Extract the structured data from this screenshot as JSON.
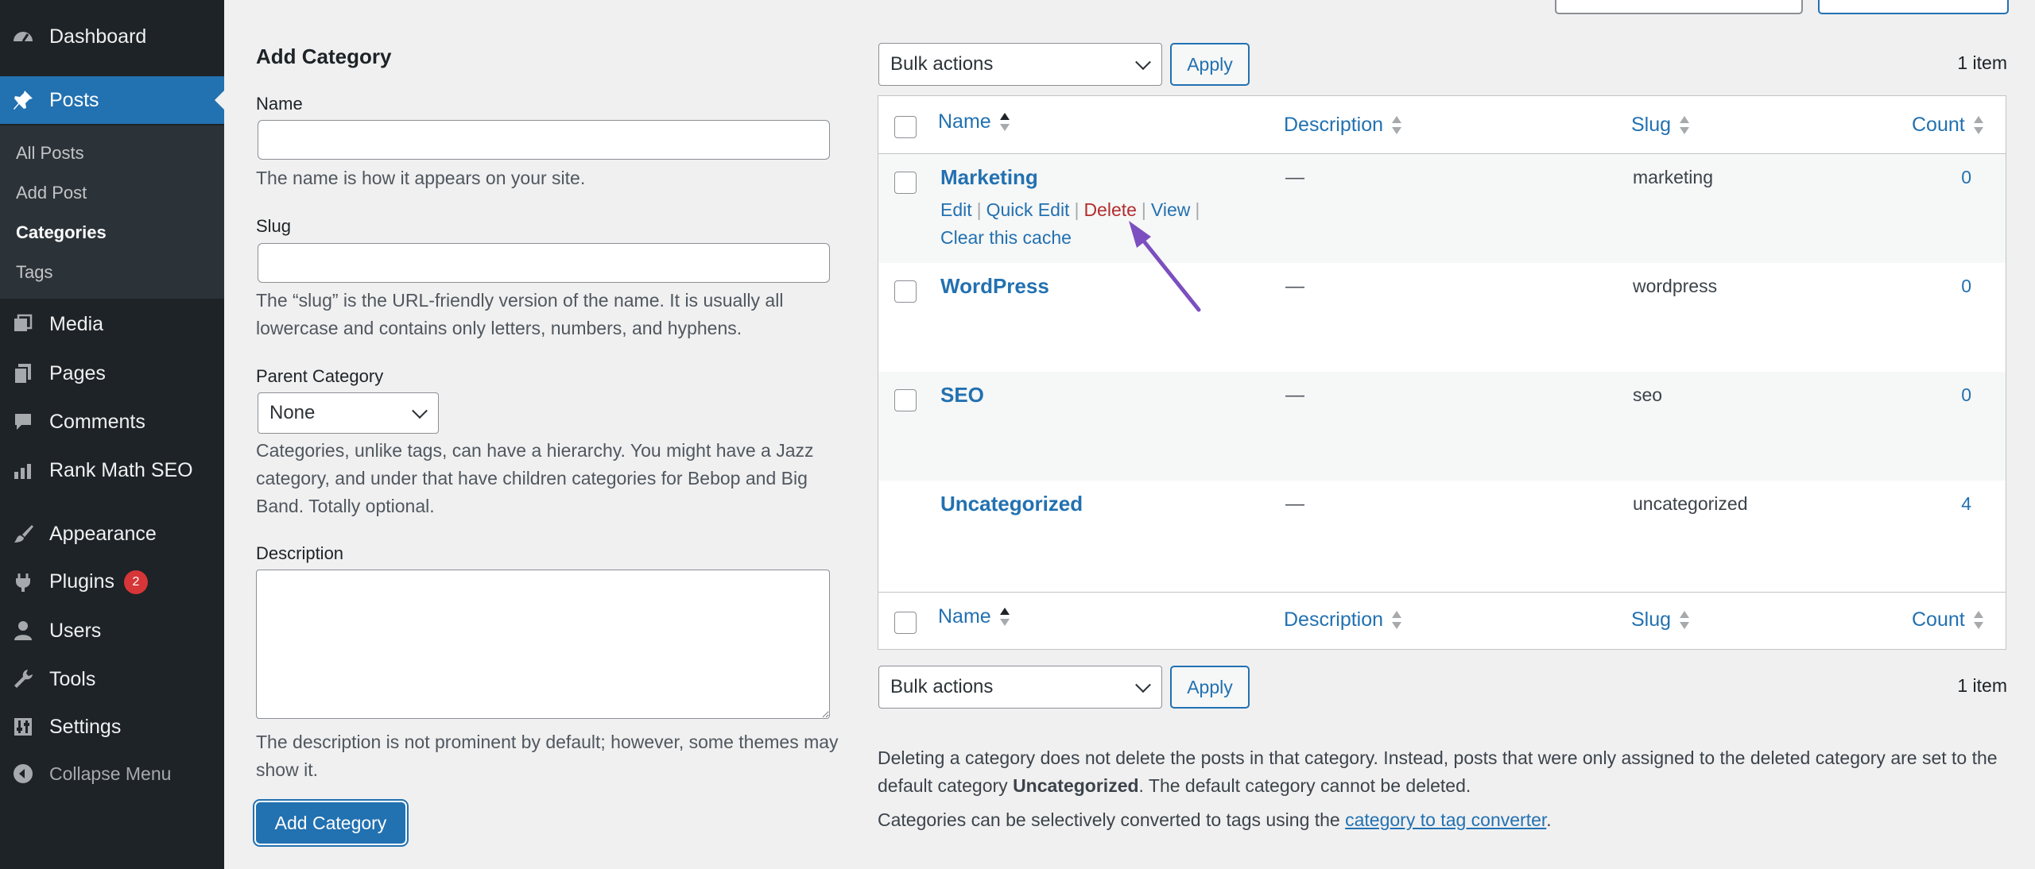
{
  "sidebar": {
    "items": [
      {
        "label": "Dashboard",
        "icon": "dashboard-icon"
      },
      {
        "label": "Posts",
        "icon": "pushpin-icon",
        "active": true
      },
      {
        "label": "Media",
        "icon": "media-icon"
      },
      {
        "label": "Pages",
        "icon": "pages-icon"
      },
      {
        "label": "Comments",
        "icon": "comment-icon"
      },
      {
        "label": "Rank Math SEO",
        "icon": "chart-icon"
      },
      {
        "label": "Appearance",
        "icon": "paintbrush-icon"
      },
      {
        "label": "Plugins",
        "icon": "plug-icon",
        "badge": "2"
      },
      {
        "label": "Users",
        "icon": "user-icon"
      },
      {
        "label": "Tools",
        "icon": "wrench-icon"
      },
      {
        "label": "Settings",
        "icon": "settings-icon"
      }
    ],
    "submenu": [
      "All Posts",
      "Add Post",
      "Categories",
      "Tags"
    ],
    "collapse_label": "Collapse Menu"
  },
  "form": {
    "title": "Add Category",
    "name_label": "Name",
    "name_help": "The name is how it appears on your site.",
    "slug_label": "Slug",
    "slug_help": "The “slug” is the URL-friendly version of the name. It is usually all lowercase and contains only letters, numbers, and hyphens.",
    "parent_label": "Parent Category",
    "parent_value": "None",
    "parent_help": "Categories, unlike tags, can have a hierarchy. You might have a Jazz category, and under that have children categories for Bebop and Big Band. Totally optional.",
    "description_label": "Description",
    "description_help": "The description is not prominent by default; however, some themes may show it.",
    "submit_label": "Add Category"
  },
  "table": {
    "bulk_actions": "Bulk actions",
    "apply_label": "Apply",
    "item_count": "1 item",
    "columns": {
      "name": "Name",
      "description": "Description",
      "slug": "Slug",
      "count": "Count"
    },
    "rows": [
      {
        "name": "Marketing",
        "description": "—",
        "slug": "marketing",
        "count": "0"
      },
      {
        "name": "WordPress",
        "description": "—",
        "slug": "wordpress",
        "count": "0"
      },
      {
        "name": "SEO",
        "description": "—",
        "slug": "seo",
        "count": "0"
      },
      {
        "name": "Uncategorized",
        "description": "—",
        "slug": "uncategorized",
        "count": "4"
      }
    ],
    "row_actions": {
      "edit": "Edit",
      "quick_edit": "Quick Edit",
      "delete": "Delete",
      "view": "View",
      "clear_cache": "Clear this cache",
      "separator": "|"
    }
  },
  "notes": {
    "line1_a": "Deleting a category does not delete the posts in that category. Instead, posts that were only assigned to the deleted category are set to the default category ",
    "line1_bold": "Uncategorized",
    "line1_b": ". The default category cannot be deleted.",
    "line2_a": "Categories can be selectively converted to tags using the ",
    "line2_link": "category to tag converter",
    "line2_b": "."
  },
  "colors": {
    "accent": "#2271b1",
    "sidebar": "#1d2327",
    "delete": "#b32d2e",
    "annotation_arrow": "#7b4fbf"
  }
}
